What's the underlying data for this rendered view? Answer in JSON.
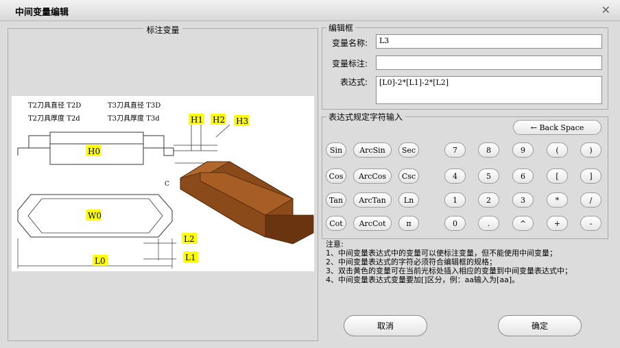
{
  "window": {
    "title": "中间变量编辑"
  },
  "left": {
    "title": "标注变量",
    "drawing": {
      "t2_dia": "T2刀具直径  T2D",
      "t2_thk": "T2刀具厚度  T2d",
      "t3_dia": "T3刀具直径  T3D",
      "t3_thk": "T3刀具厚度  T3d",
      "vars": [
        "H1",
        "H2",
        "H3",
        "H0",
        "W0",
        "L2",
        "L1",
        "L0"
      ],
      "c_label": "C"
    }
  },
  "editor": {
    "group_label": "编辑框",
    "name_label": "变量名称:",
    "name_value": "L3",
    "mark_label": "变量标注:",
    "mark_value": "",
    "expr_label": "表达式:",
    "expr_value": "[L0]-2*[L1]-2*[L2]"
  },
  "keypad": {
    "group_label": "表达式规定字符输入",
    "backspace": "←  Back Space",
    "funcs": [
      "Sin",
      "ArcSin",
      "Sec",
      "Cos",
      "ArcCos",
      "Csc",
      "Tan",
      "ArcTan",
      "Ln",
      "Cot",
      "ArcCot",
      "π"
    ],
    "keys": [
      "7",
      "8",
      "9",
      "(",
      ")",
      "4",
      "5",
      "6",
      "[",
      "]",
      "1",
      "2",
      "3",
      "*",
      "/",
      "0",
      ".",
      "^",
      "+",
      "-"
    ]
  },
  "notes": [
    "注意:",
    "1、中间变量表达式中的变量可以使标注变量，但不能使用中间变量；",
    "2、中间变量表达式的字符必须符合编辑框的规格；",
    "3、双击黄色的变量可在当前光标处插入相应的变量到中间变量表达式中；",
    "4、中间变量表达式变量要加[]区分，例：aa输入为[aa]。"
  ],
  "buttons": {
    "cancel": "取消",
    "ok": "确定"
  },
  "colors": {
    "highlight": "#ffff00",
    "wood": "#8b4a1a"
  }
}
